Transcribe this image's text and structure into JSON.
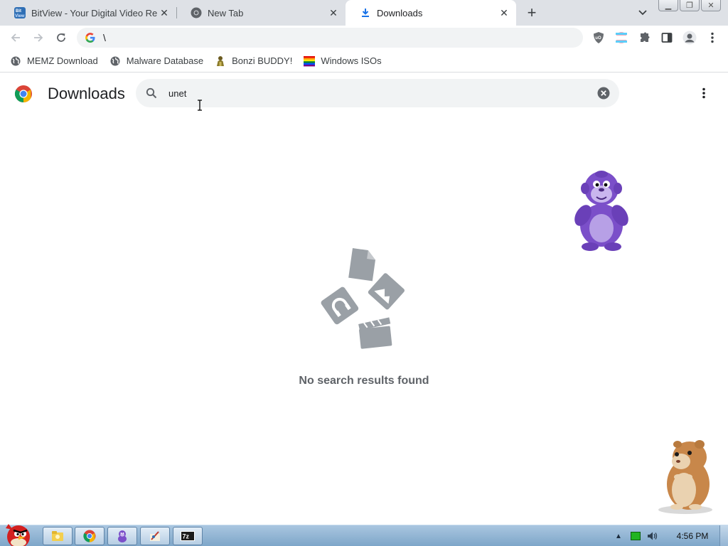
{
  "browser": {
    "tabs": [
      {
        "title": "BitView - Your Digital Video Re",
        "icon": "bitview-icon",
        "active": false
      },
      {
        "title": "New Tab",
        "icon": "chrome-icon",
        "active": false
      },
      {
        "title": "Downloads",
        "icon": "download-icon",
        "active": true
      }
    ],
    "omnibox": {
      "url": "\\"
    },
    "bookmarks": [
      {
        "label": "MEMZ Download",
        "icon": "globe-icon"
      },
      {
        "label": "Malware Database",
        "icon": "globe-icon"
      },
      {
        "label": "Bonzi BUDDY!",
        "icon": "bonzi-icon"
      },
      {
        "label": "Windows ISOs",
        "icon": "rainbow-icon"
      }
    ]
  },
  "downloads": {
    "title": "Downloads",
    "search_value": "unet",
    "empty_message": "No search results found"
  },
  "taskbar": {
    "clock": "4:56 PM"
  },
  "colors": {
    "tabstrip": "#dee1e6",
    "omnibox": "#f1f3f4",
    "empty_text": "#5f6368",
    "illustration": "#9aa0a6",
    "taskbar": "#7ea6c9",
    "bonzi_purple": "#7b4fc9"
  }
}
